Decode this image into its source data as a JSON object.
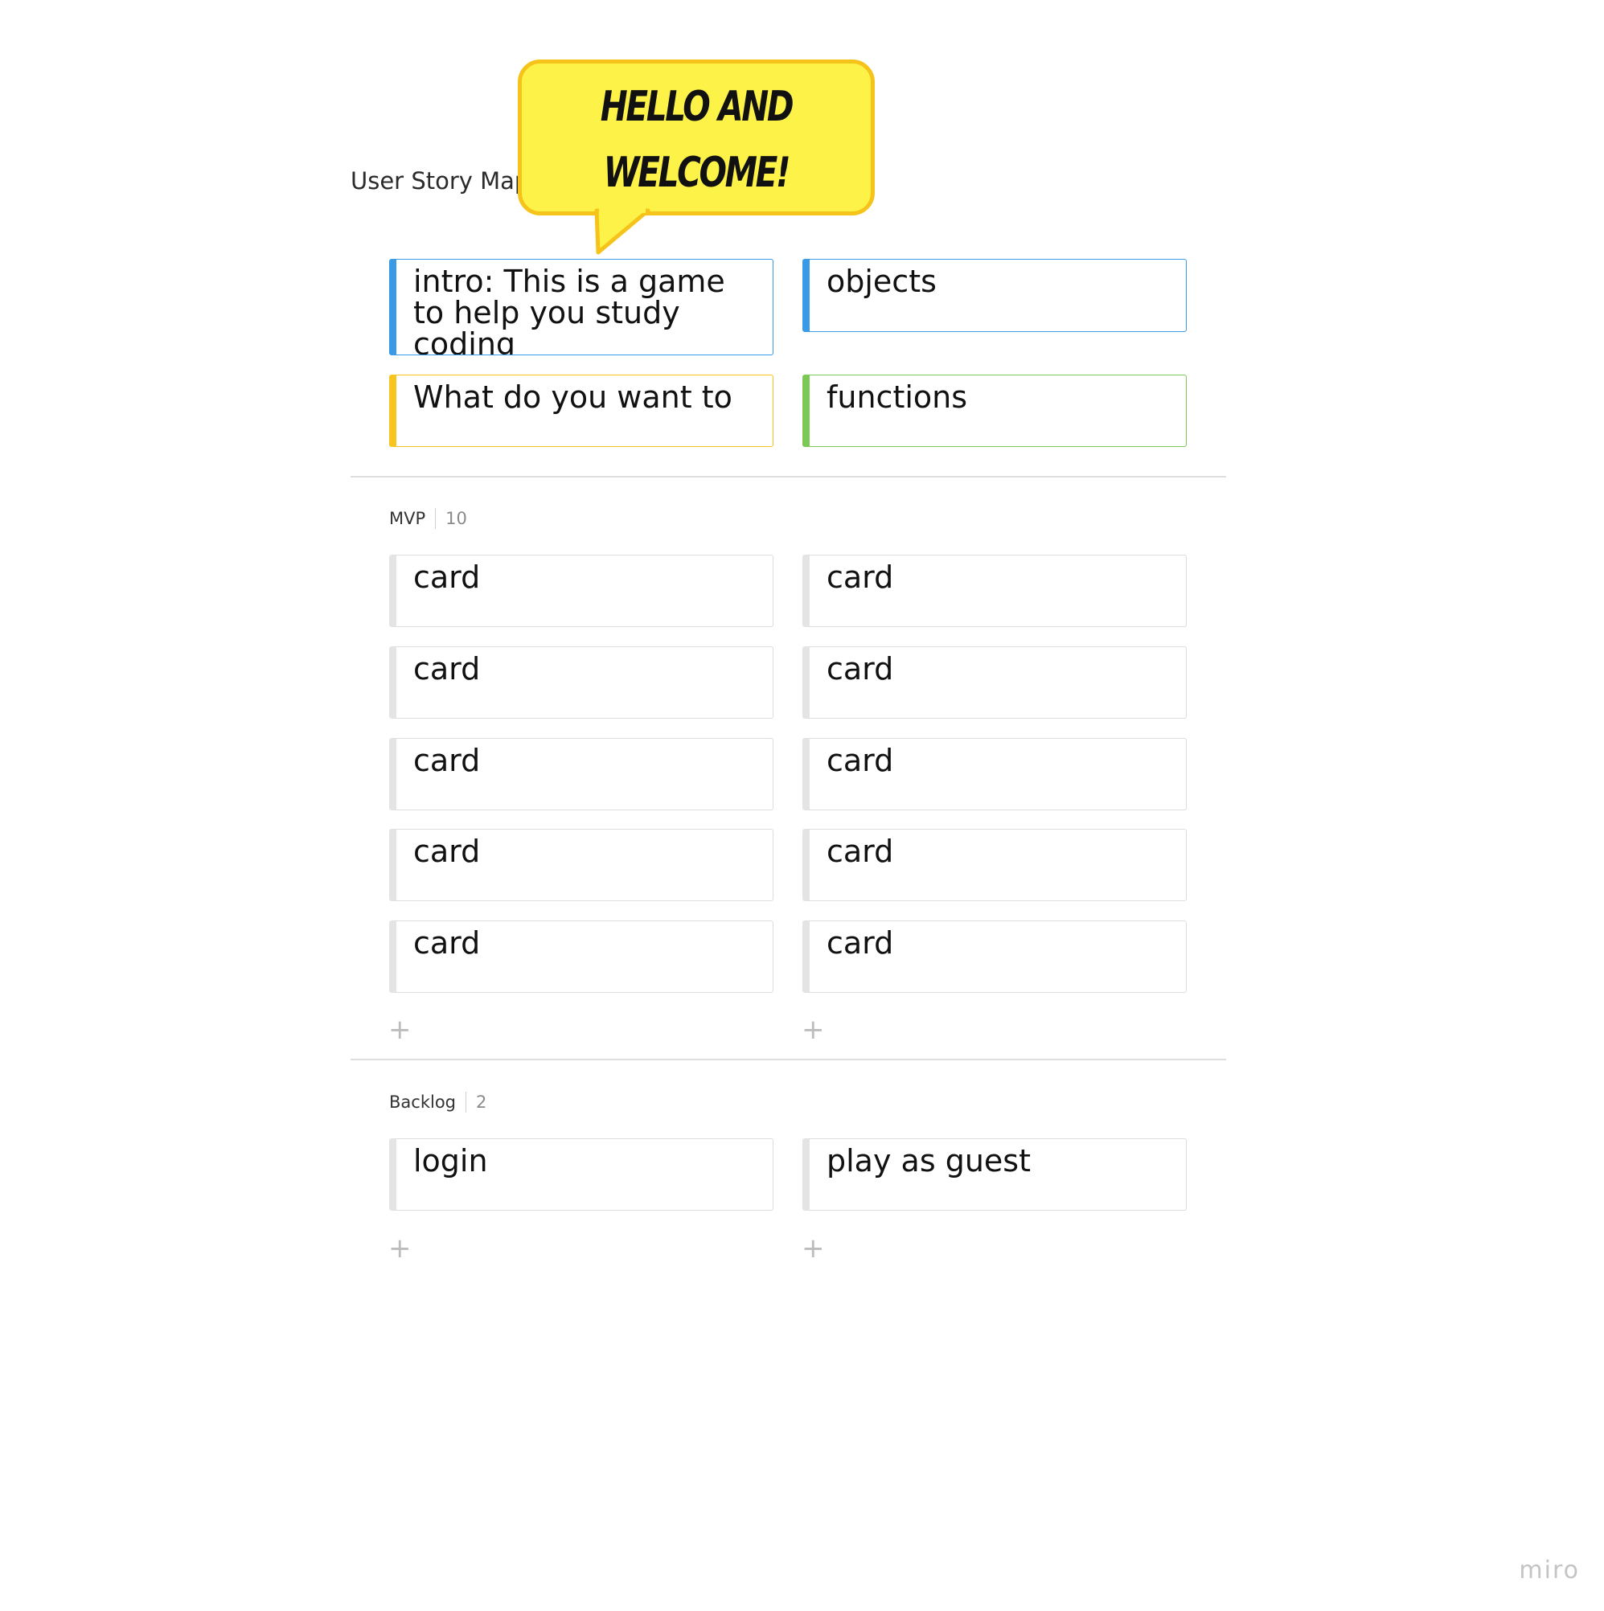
{
  "board": {
    "title": "User Story Map"
  },
  "callout": {
    "text": "HELLO AND WELCOME!",
    "fill_color": "#fdf247",
    "border_color": "#f5c319"
  },
  "header_cards": [
    {
      "text": "intro: This is a game to help you study coding",
      "color": "#3a9ae6"
    },
    {
      "text": "objects",
      "color": "#3a9ae6"
    },
    {
      "text": "What do you want to",
      "color": "#f7c51e"
    },
    {
      "text": "functions",
      "color": "#7cc855"
    }
  ],
  "rows": [
    {
      "name": "MVP",
      "count": "10",
      "cards": [
        "card",
        "card",
        "card",
        "card",
        "card",
        "card",
        "card",
        "card",
        "card",
        "card"
      ],
      "add_icon": "+"
    },
    {
      "name": "Backlog",
      "count": "2",
      "cards": [
        "login",
        "play as guest"
      ],
      "add_icon": "+"
    }
  ],
  "watermark": "miro"
}
